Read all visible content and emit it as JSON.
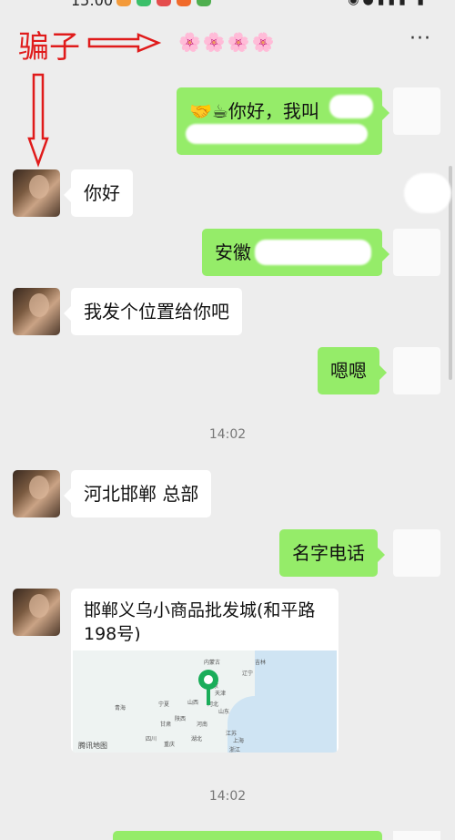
{
  "status_bar": {
    "time": "15:00"
  },
  "annotations": {
    "label": "骗子"
  },
  "header": {
    "title": "🌸🌸🌸🌸",
    "more": "···"
  },
  "messages": [
    {
      "side": "out",
      "text": "🤝☕你好，我叫"
    },
    {
      "side": "in",
      "text": "你好"
    },
    {
      "side": "out",
      "text": "安徽"
    },
    {
      "side": "in",
      "text": "我发个位置给你吧"
    },
    {
      "side": "out",
      "text": "嗯嗯"
    },
    {
      "side": "in",
      "text": "河北邯郸 总部"
    },
    {
      "side": "out",
      "text": "名字电话"
    }
  ],
  "timestamps": [
    "14:02",
    "14:02"
  ],
  "location": {
    "title": "邯郸义乌小商品批发城(和平路198号)",
    "map_labels": [
      "内蒙古",
      "辽宁",
      "吉林",
      "北京",
      "天津",
      "山西",
      "河北",
      "青海",
      "宁夏",
      "甘肃",
      "陕西",
      "河南",
      "山东",
      "江苏",
      "上海",
      "浙江",
      "四川",
      "重庆",
      "湖北"
    ],
    "credit": "腾讯地图"
  }
}
